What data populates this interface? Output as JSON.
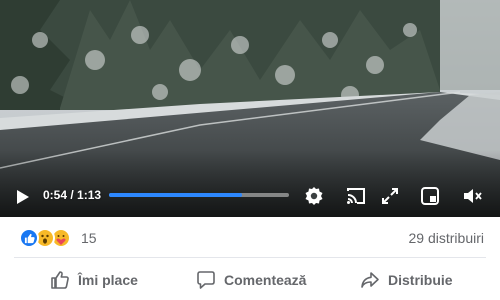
{
  "video": {
    "current_time": "0:54",
    "duration": "1:13",
    "time_separator": " / ",
    "progress_fraction": 0.74,
    "accent_color": "#2d88ff",
    "icons": [
      "play-icon",
      "settings-gear-icon",
      "cast-icon",
      "fullscreen-icon",
      "miniplayer-icon",
      "volume-icon"
    ]
  },
  "reactions": {
    "types": [
      "like",
      "wow",
      "care"
    ],
    "count": "15",
    "shares": "29 distribuiri"
  },
  "actions": {
    "like_label": "Îmi place",
    "comment_label": "Comentează",
    "share_label": "Distribuie"
  }
}
